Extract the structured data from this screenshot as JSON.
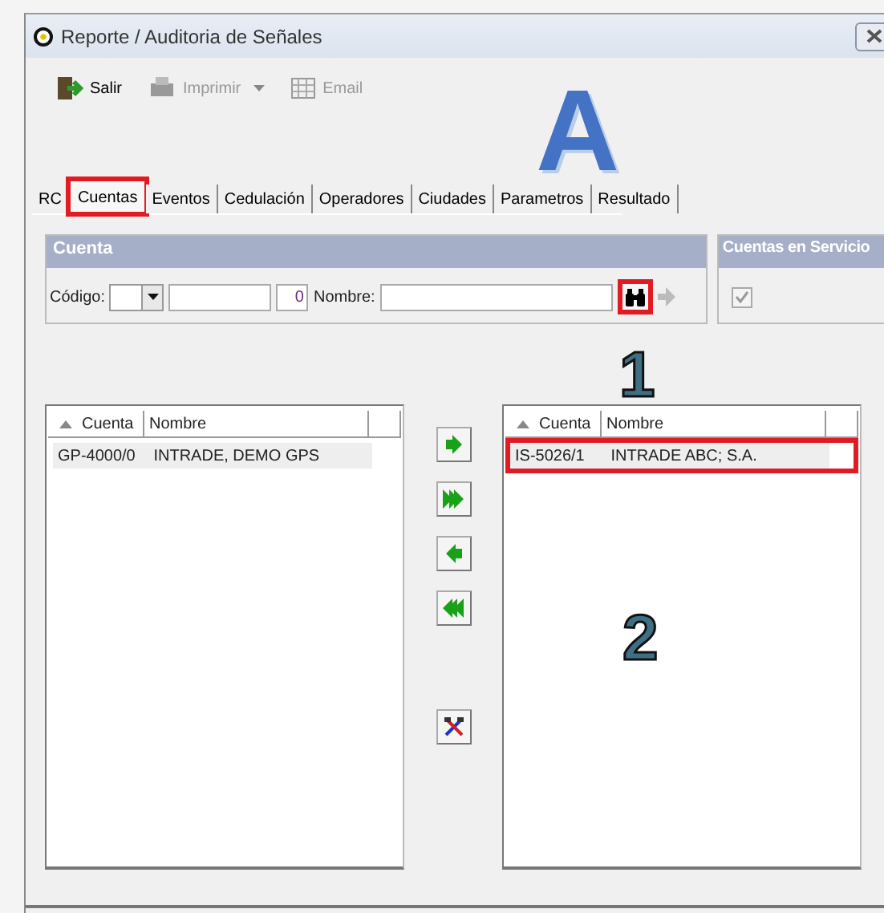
{
  "window": {
    "title": "Reporte / Auditoria de Señales"
  },
  "toolbar": [
    {
      "label": "Salir",
      "disabled": false,
      "dropdown": false,
      "kind": "exit"
    },
    {
      "label": "Imprimir",
      "disabled": true,
      "dropdown": true,
      "kind": "print"
    },
    {
      "label": "Email",
      "disabled": true,
      "dropdown": false,
      "kind": "email"
    }
  ],
  "tabs": [
    {
      "label": "RC",
      "selected": false,
      "highlighted": false
    },
    {
      "label": "Cuentas",
      "selected": true,
      "highlighted": true
    },
    {
      "label": "Eventos",
      "selected": false,
      "highlighted": false
    },
    {
      "label": "Cedulación",
      "selected": false,
      "highlighted": false
    },
    {
      "label": "Operadores",
      "selected": false,
      "highlighted": false
    },
    {
      "label": "Ciudades",
      "selected": false,
      "highlighted": false
    },
    {
      "label": "Parametros",
      "selected": false,
      "highlighted": false
    },
    {
      "label": "Resultado",
      "selected": false,
      "highlighted": false
    }
  ],
  "cuenta": {
    "title": "Cuenta",
    "codigo_label": "Código:",
    "number_value": "0",
    "nombre_label": "Nombre:",
    "search_highlighted": true
  },
  "servicio": {
    "title": "Cuentas en Servicio",
    "checked": true
  },
  "left_list": {
    "columns": [
      "Cuenta",
      "Nombre"
    ],
    "rows": [
      {
        "cells": [
          "GP-4000/0",
          "INTRADE, DEMO GPS"
        ],
        "highlighted": false
      }
    ]
  },
  "right_list": {
    "columns": [
      "Cuenta",
      "Nombre"
    ],
    "rows": [
      {
        "cells": [
          "IS-5026/1",
          "INTRADE ABC; S.A."
        ],
        "highlighted": true
      }
    ]
  },
  "move_buttons": [
    {
      "kind": "right"
    },
    {
      "kind": "all-right"
    },
    {
      "kind": "left"
    },
    {
      "kind": "all-left"
    },
    {
      "kind": "tools"
    }
  ],
  "annotations": [
    {
      "text": "A",
      "kind": "letter"
    },
    {
      "text": "1",
      "kind": "number-top"
    },
    {
      "text": "2",
      "kind": "number-mid"
    }
  ]
}
